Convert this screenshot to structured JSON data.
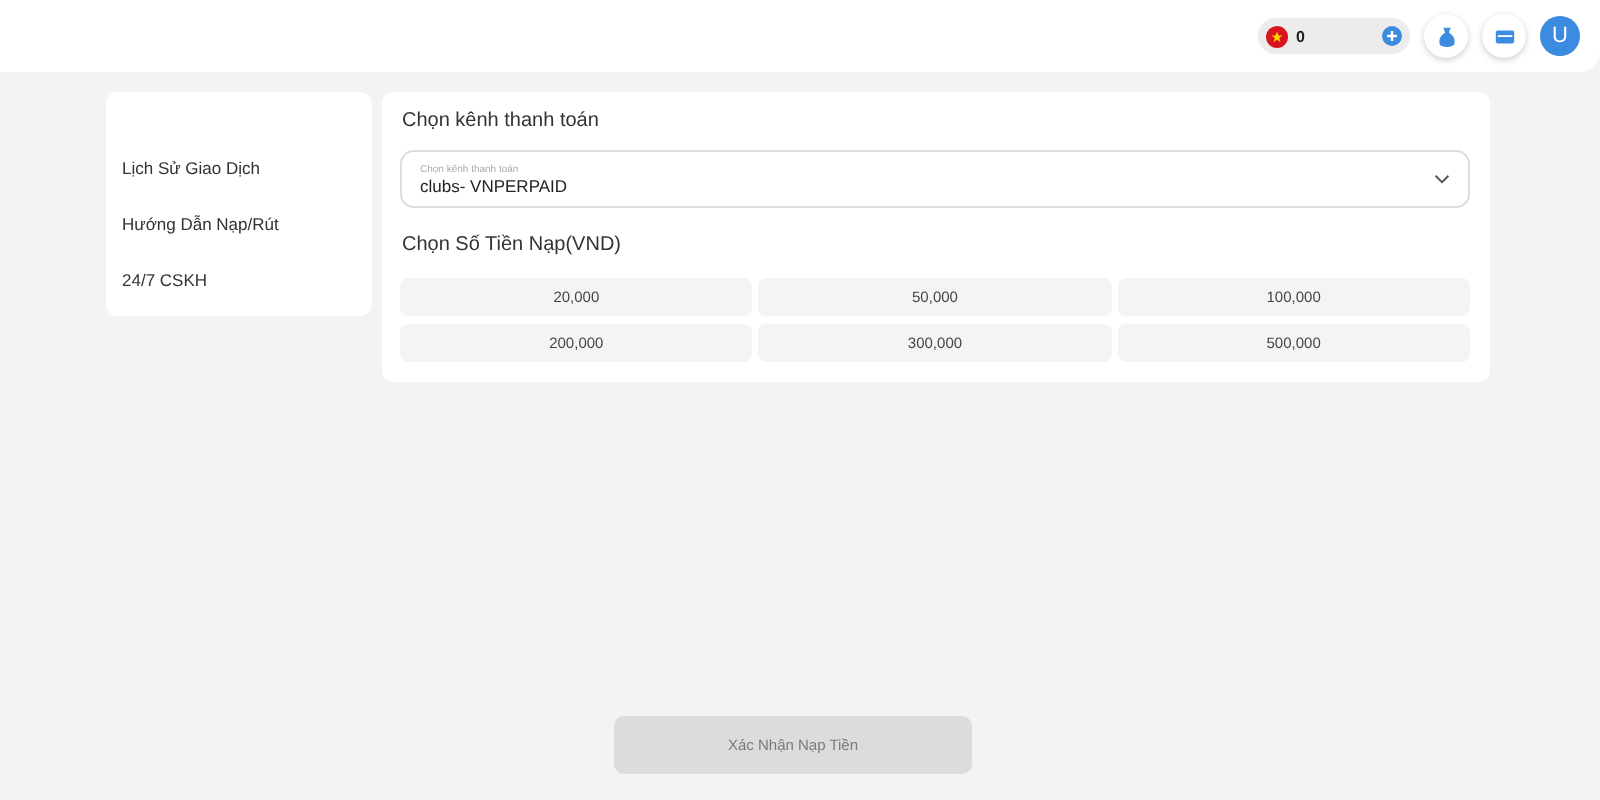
{
  "header": {
    "balance": "0",
    "avatar": "U"
  },
  "sidebar": {
    "items": [
      {
        "label": "Lịch Sử Giao Dịch",
        "selected": false
      },
      {
        "label": "Hướng Dẫn Nạp/Rút",
        "selected": false
      },
      {
        "label": "24/7 CSKH",
        "selected": false
      }
    ]
  },
  "payment": {
    "title": "Chọn kênh thanh toán",
    "channel_field": {
      "label": "Chọn kênh thanh toán",
      "value": "clubs- VNPERPAID"
    },
    "amount_title": "Chọn Số Tiền Nạp(VND)",
    "amounts": [
      {
        "label": "20,000",
        "selected": false
      },
      {
        "label": "50,000",
        "selected": false
      },
      {
        "label": "100,000",
        "selected": false
      },
      {
        "label": "200,000",
        "selected": false
      },
      {
        "label": "300,000",
        "selected": false
      },
      {
        "label": "500,000",
        "selected": false
      }
    ]
  },
  "confirm_button": {
    "label": "Xác Nhận Nạp Tiền",
    "disabled": true
  }
}
